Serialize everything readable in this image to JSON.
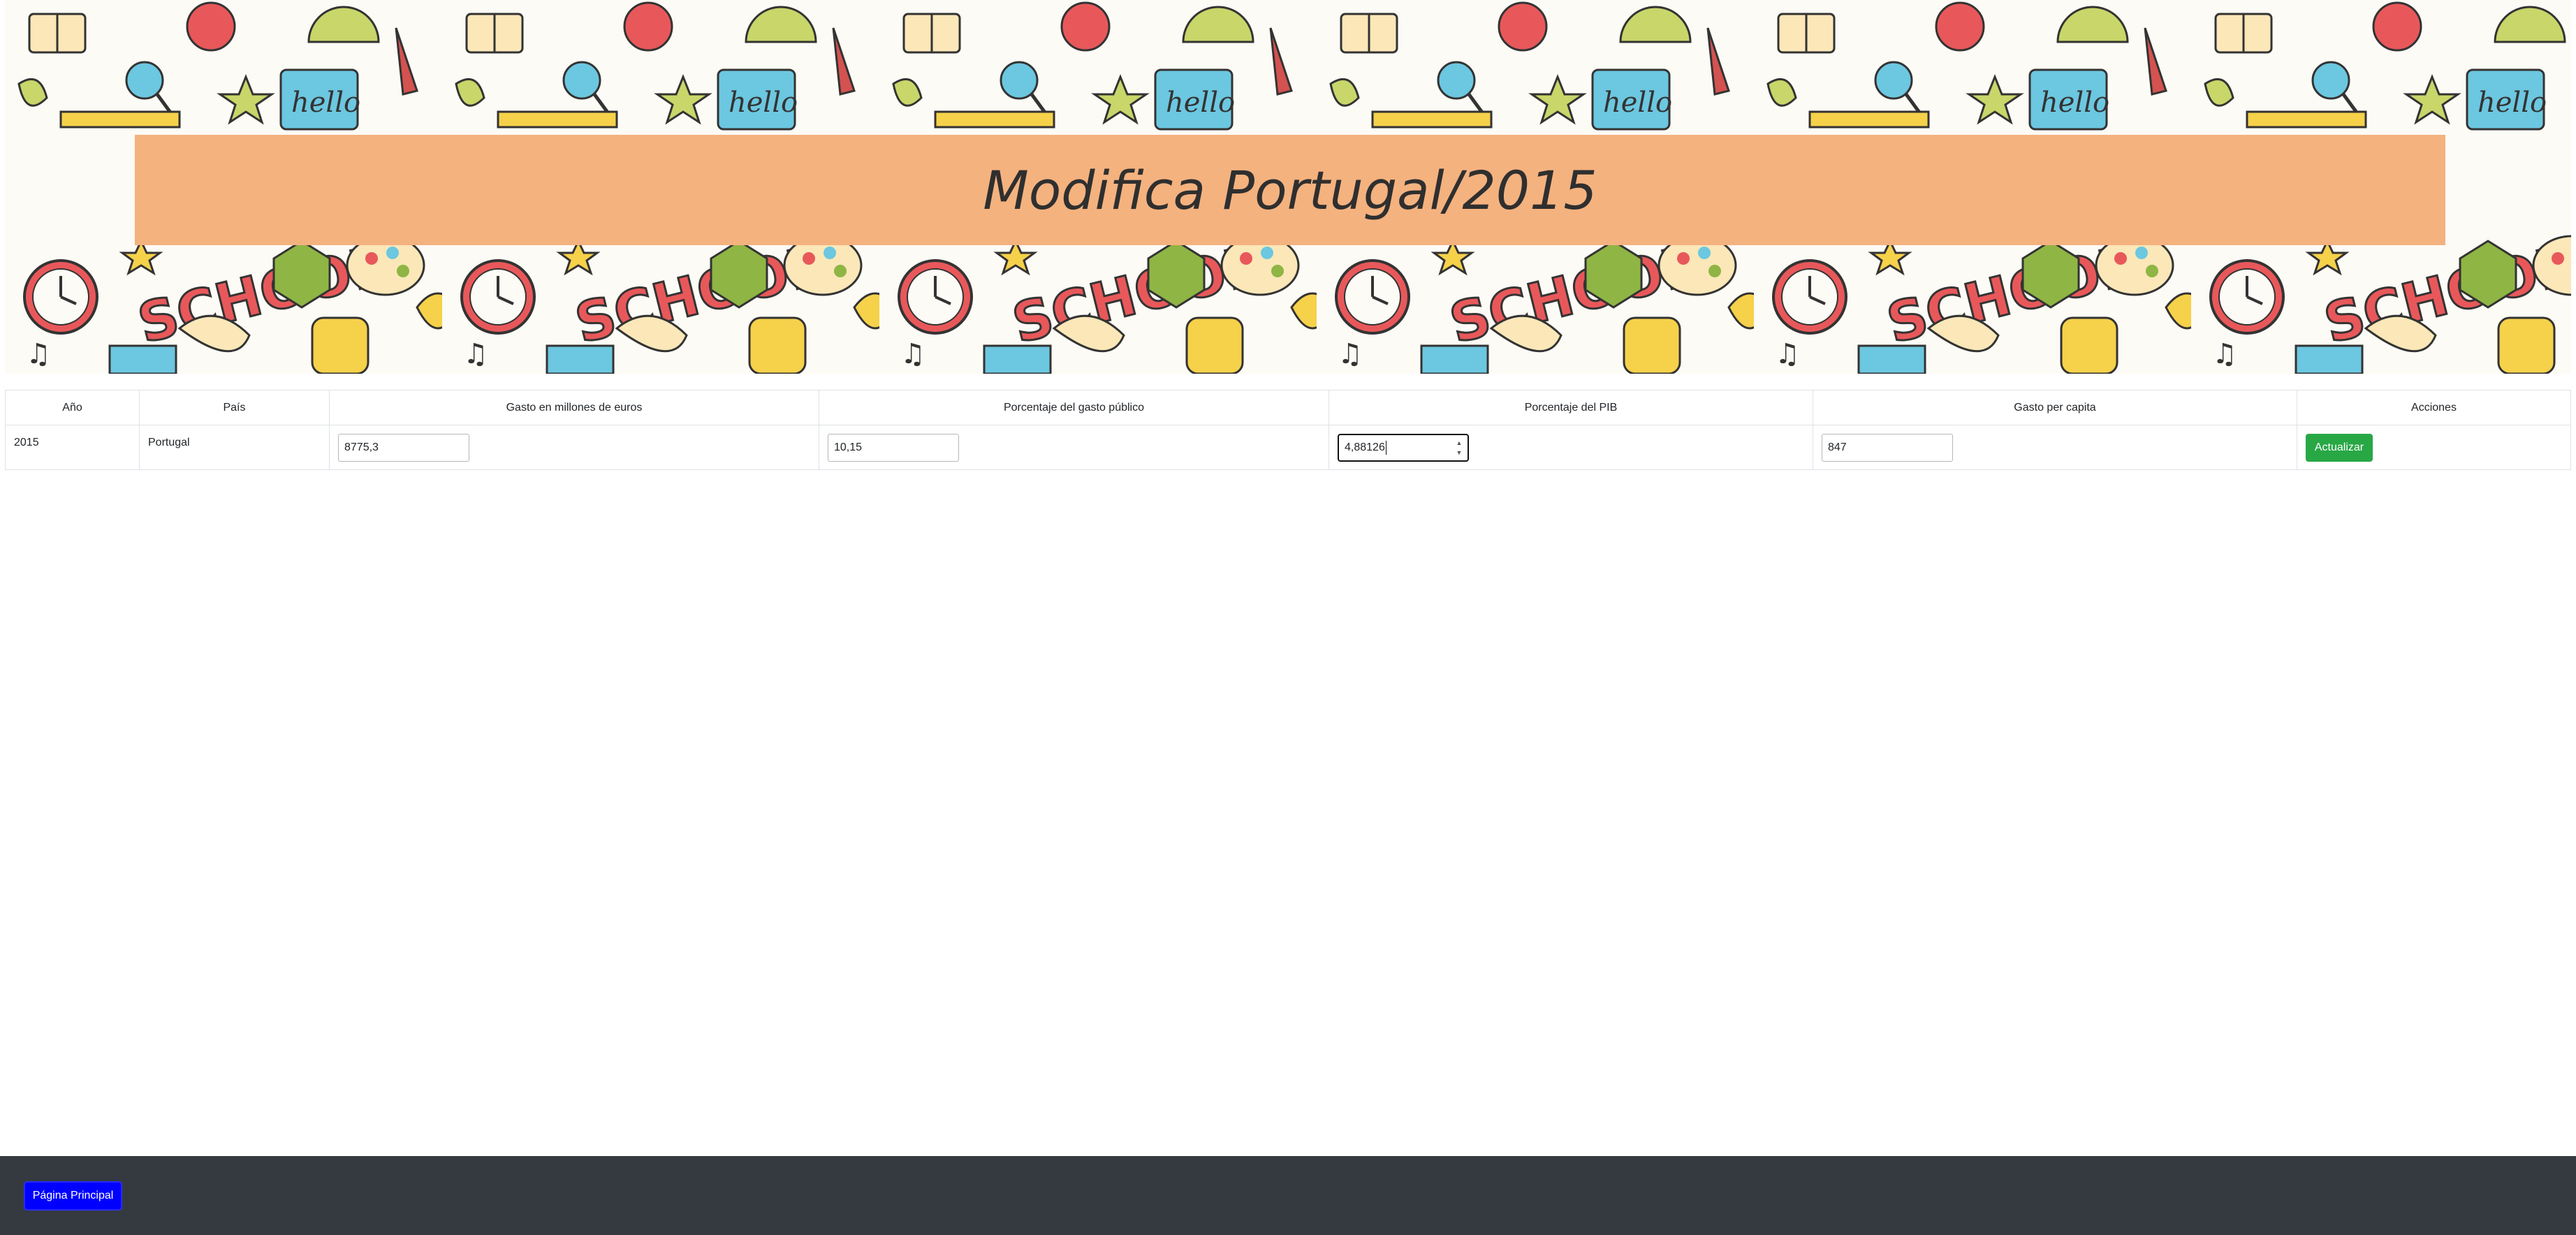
{
  "banner": {
    "title": "Modifica Portugal/2015",
    "background_color": "#f4b27f",
    "doodle_words": [
      "hello",
      "SCHOOL"
    ]
  },
  "table": {
    "headers": [
      "Año",
      "País",
      "Gasto en millones de euros",
      "Porcentaje del gasto público",
      "Porcentaje del PIB",
      "Gasto per capita",
      "Acciones"
    ],
    "row": {
      "year": "2015",
      "country": "Portugal",
      "expense_millions": "8775,3",
      "public_spending_pct": "10,15",
      "gdp_pct": "4,88126",
      "per_capita": "847",
      "action_label": "Actualizar"
    }
  },
  "footer": {
    "home_label": "Página Principal"
  },
  "colors": {
    "update_button": "#28a745",
    "home_button": "#0000ff",
    "footer_bg": "#343a40"
  }
}
